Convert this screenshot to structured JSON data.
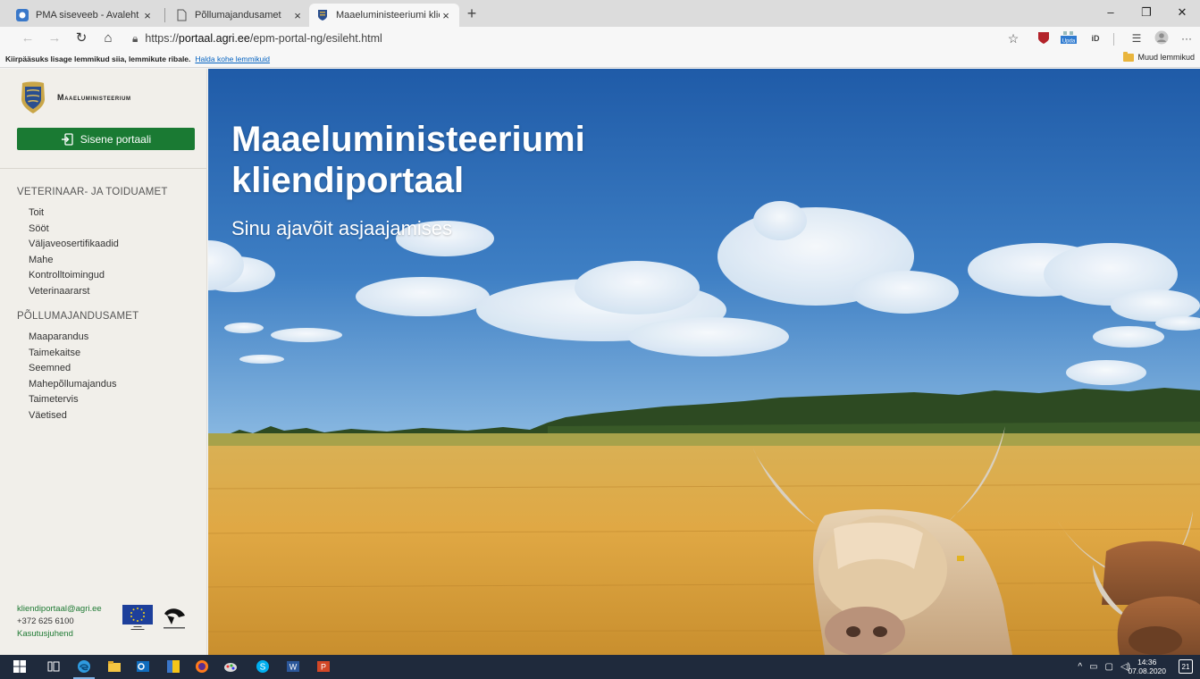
{
  "browser": {
    "tabs": [
      {
        "title": "PMA siseveeb - Avaleht",
        "close": "×"
      },
      {
        "title": "Põllumajandusamet",
        "close": "×"
      },
      {
        "title": "Maaeluministeeriumi kliendiport",
        "close": "×"
      }
    ],
    "new_tab": "+",
    "window_controls": {
      "minimize": "–",
      "restore": "❐",
      "close": "✕"
    },
    "nav": {
      "back": "←",
      "forward": "→",
      "reload": "↻",
      "home": "⌂"
    },
    "url": {
      "prefix": "https://",
      "host": "portaal.agri.ee",
      "path": "/epm-portal-ng/esileht.html"
    },
    "favorites_bar": {
      "hint": "Kiirpääsuks lisage lemmikud siia, lemmikute ribale.",
      "link": "Halda kohe lemmikuid",
      "other": "Muud lemmikud"
    },
    "ext_labels": {
      "id": "iD",
      "upd": "Upda",
      "more": "···"
    }
  },
  "sidebar": {
    "brand": "Maaeluministeerium",
    "login_button": "Sisene portaali",
    "sections": [
      {
        "title": "VETERINAAR- JA TOIDUAMET",
        "items": [
          "Toit",
          "Sööt",
          "Väljaveosertifikaadid",
          "Mahe",
          "Kontrolltoimingud",
          "Veterinaararst"
        ]
      },
      {
        "title": "PÕLLUMAJANDUSAMET",
        "items": [
          "Maaparandus",
          "Taimekaitse",
          "Seemned",
          "Mahepõllumajandus",
          "Taimetervis",
          "Väetised"
        ]
      }
    ],
    "footer": {
      "email": "kliendiportaal@agri.ee",
      "phone": "+372 625 6100",
      "guide": "Kasutusjuhend"
    }
  },
  "hero": {
    "title": "Maaeluministeeriumi kliendiportaal",
    "subtitle": "Sinu ajavõit asjaajamises"
  },
  "taskbar": {
    "time": "14:36",
    "date": "07.08.2020",
    "notifications": "21"
  },
  "colors": {
    "brand_green": "#1a7a33",
    "link_green": "#1f7a34",
    "sky_blue": "#2a66b4",
    "field_gold": "#d8a640",
    "taskbar": "#1f2a3c"
  }
}
